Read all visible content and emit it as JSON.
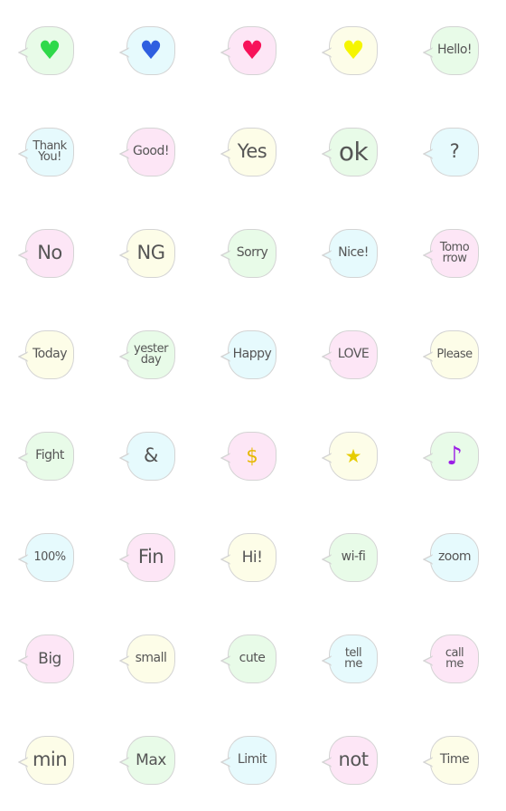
{
  "bubble_colors": {
    "green": "#e8fbe8",
    "blue": "#e6fafd",
    "pink": "#fde6f6",
    "yellow": "#fdfde8"
  },
  "border_color": "#d4d4d4",
  "text_color": "#555555",
  "stickers": [
    {
      "row": 0,
      "col": 0,
      "bg": "green",
      "kind": "icon",
      "icon": "heart-icon",
      "glyph": "♥",
      "color": "#2fd94a",
      "size": "s1"
    },
    {
      "row": 0,
      "col": 1,
      "bg": "blue",
      "kind": "icon",
      "icon": "heart-icon",
      "glyph": "♥",
      "color": "#2f5fe0",
      "size": "s1"
    },
    {
      "row": 0,
      "col": 2,
      "bg": "pink",
      "kind": "icon",
      "icon": "heart-icon",
      "glyph": "♥",
      "color": "#f7135a",
      "size": "s1"
    },
    {
      "row": 0,
      "col": 3,
      "bg": "yellow",
      "kind": "icon",
      "icon": "heart-icon",
      "glyph": "♥",
      "color": "#f5f500",
      "size": "s1"
    },
    {
      "row": 0,
      "col": 4,
      "bg": "green",
      "kind": "text",
      "text": "Hello!",
      "size": "s4"
    },
    {
      "row": 1,
      "col": 0,
      "bg": "blue",
      "kind": "text",
      "text": "Thank\nYou!",
      "size": "s5"
    },
    {
      "row": 1,
      "col": 1,
      "bg": "pink",
      "kind": "text",
      "text": "Good!",
      "size": "s4"
    },
    {
      "row": 1,
      "col": 2,
      "bg": "yellow",
      "kind": "text",
      "text": "Yes",
      "size": "s2"
    },
    {
      "row": 1,
      "col": 3,
      "bg": "green",
      "kind": "text",
      "text": "ok",
      "size": "s1"
    },
    {
      "row": 1,
      "col": 4,
      "bg": "blue",
      "kind": "text",
      "text": "?",
      "size": "s2"
    },
    {
      "row": 2,
      "col": 0,
      "bg": "pink",
      "kind": "text",
      "text": "No",
      "size": "s2"
    },
    {
      "row": 2,
      "col": 1,
      "bg": "yellow",
      "kind": "text",
      "text": "NG",
      "size": "s2"
    },
    {
      "row": 2,
      "col": 2,
      "bg": "green",
      "kind": "text",
      "text": "Sorry",
      "size": "s4"
    },
    {
      "row": 2,
      "col": 3,
      "bg": "blue",
      "kind": "text",
      "text": "Nice!",
      "size": "s4"
    },
    {
      "row": 2,
      "col": 4,
      "bg": "pink",
      "kind": "text",
      "text": "Tomo\nrrow",
      "size": "s5"
    },
    {
      "row": 3,
      "col": 0,
      "bg": "yellow",
      "kind": "text",
      "text": "Today",
      "size": "s4"
    },
    {
      "row": 3,
      "col": 1,
      "bg": "green",
      "kind": "text",
      "text": "yester\nday",
      "size": "s5"
    },
    {
      "row": 3,
      "col": 2,
      "bg": "blue",
      "kind": "text",
      "text": "Happy",
      "size": "s4"
    },
    {
      "row": 3,
      "col": 3,
      "bg": "pink",
      "kind": "text",
      "text": "LOVE",
      "size": "s4"
    },
    {
      "row": 3,
      "col": 4,
      "bg": "yellow",
      "kind": "text",
      "text": "Please",
      "size": "s5"
    },
    {
      "row": 4,
      "col": 0,
      "bg": "green",
      "kind": "text",
      "text": "Fight",
      "size": "s4"
    },
    {
      "row": 4,
      "col": 1,
      "bg": "blue",
      "kind": "text",
      "text": "&",
      "size": "s2"
    },
    {
      "row": 4,
      "col": 2,
      "bg": "pink",
      "kind": "icon",
      "icon": "dollar-icon",
      "glyph": "$",
      "color": "#e6b800",
      "size": "s2"
    },
    {
      "row": 4,
      "col": 3,
      "bg": "yellow",
      "kind": "icon",
      "icon": "star-icon",
      "glyph": "★",
      "color": "#e6cc00",
      "size": "s2"
    },
    {
      "row": 4,
      "col": 4,
      "bg": "green",
      "kind": "icon",
      "icon": "music-note-icon",
      "glyph": "♪",
      "color": "#9b1ee6",
      "size": "s1"
    },
    {
      "row": 5,
      "col": 0,
      "bg": "blue",
      "kind": "text",
      "text": "100%",
      "size": "s5"
    },
    {
      "row": 5,
      "col": 1,
      "bg": "pink",
      "kind": "text",
      "text": "Fin",
      "size": "s2"
    },
    {
      "row": 5,
      "col": 2,
      "bg": "yellow",
      "kind": "text",
      "text": "Hi!",
      "size": "s3"
    },
    {
      "row": 5,
      "col": 3,
      "bg": "green",
      "kind": "text",
      "text": "wi-fi",
      "size": "s4"
    },
    {
      "row": 5,
      "col": 4,
      "bg": "blue",
      "kind": "text",
      "text": "zoom",
      "size": "s4"
    },
    {
      "row": 6,
      "col": 0,
      "bg": "pink",
      "kind": "text",
      "text": "Big",
      "size": "s3"
    },
    {
      "row": 6,
      "col": 1,
      "bg": "yellow",
      "kind": "text",
      "text": "small",
      "size": "s4"
    },
    {
      "row": 6,
      "col": 2,
      "bg": "green",
      "kind": "text",
      "text": "cute",
      "size": "s4"
    },
    {
      "row": 6,
      "col": 3,
      "bg": "blue",
      "kind": "text",
      "text": "tell\nme",
      "size": "s5"
    },
    {
      "row": 6,
      "col": 4,
      "bg": "pink",
      "kind": "text",
      "text": "call\nme",
      "size": "s5"
    },
    {
      "row": 7,
      "col": 0,
      "bg": "yellow",
      "kind": "text",
      "text": "min",
      "size": "s2"
    },
    {
      "row": 7,
      "col": 1,
      "bg": "green",
      "kind": "text",
      "text": "Max",
      "size": "s3"
    },
    {
      "row": 7,
      "col": 2,
      "bg": "blue",
      "kind": "text",
      "text": "Limit",
      "size": "s4"
    },
    {
      "row": 7,
      "col": 3,
      "bg": "pink",
      "kind": "text",
      "text": "not",
      "size": "s2"
    },
    {
      "row": 7,
      "col": 4,
      "bg": "yellow",
      "kind": "text",
      "text": "Time",
      "size": "s4"
    }
  ]
}
